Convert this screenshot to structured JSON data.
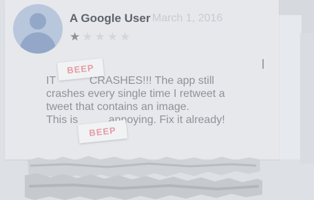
{
  "review": {
    "user_name": "A Google User",
    "date": "March 1, 2016",
    "rating": 1,
    "max_rating": 5,
    "text_lines": [
      "IT           CRASHES!!! The app still",
      "crashes every single time I retweet a",
      "tweet that contains an image.",
      "This is          annoying. Fix it already!"
    ]
  },
  "censor": {
    "sticker_1": "BEEP",
    "sticker_2": "BEEP"
  },
  "icons": {
    "avatar": "default-user-avatar-icon",
    "star": "star-icon"
  },
  "colors": {
    "background": "#dde0e4",
    "card": "#e6e8eb",
    "avatar": "#b9c7dd",
    "star_filled": "#8d9198",
    "star_empty": "#d3d6db",
    "beep_text": "#e59aa6"
  }
}
